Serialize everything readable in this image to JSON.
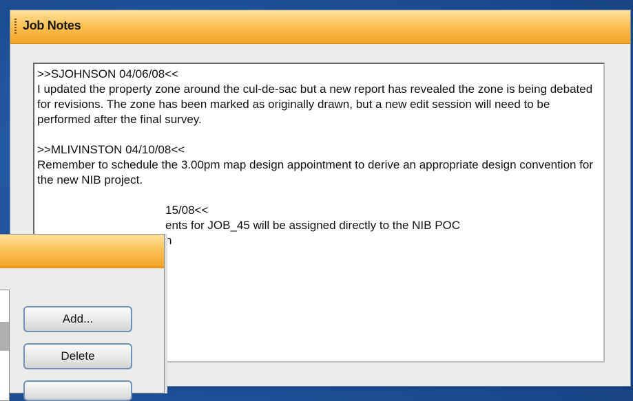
{
  "job_notes": {
    "title": "Job Notes",
    "notes": [
      {
        "header": ">>SJOHNSON 04/06/08<<",
        "body": "I updated the property zone around the cul-de-sac but a new report has revealed the zone is being debated for revisions.  The zone has been marked as originally drawn, but a new edit session will need to be performed after the final survey."
      },
      {
        "header": ">>MLIVINSTON 04/10/08<<",
        "body": "Remember to schedule the 3.00pm map design appointment to derive an appropriate design convention for the new NIB project."
      },
      {
        "header": "15/08<<",
        "body": "ents for JOB_45 will be assigned directly to the NIB POC"
      },
      {
        "header": "",
        "body": "n"
      }
    ]
  },
  "dialog": {
    "buttons": {
      "add": "Add...",
      "delete": "Delete"
    }
  }
}
